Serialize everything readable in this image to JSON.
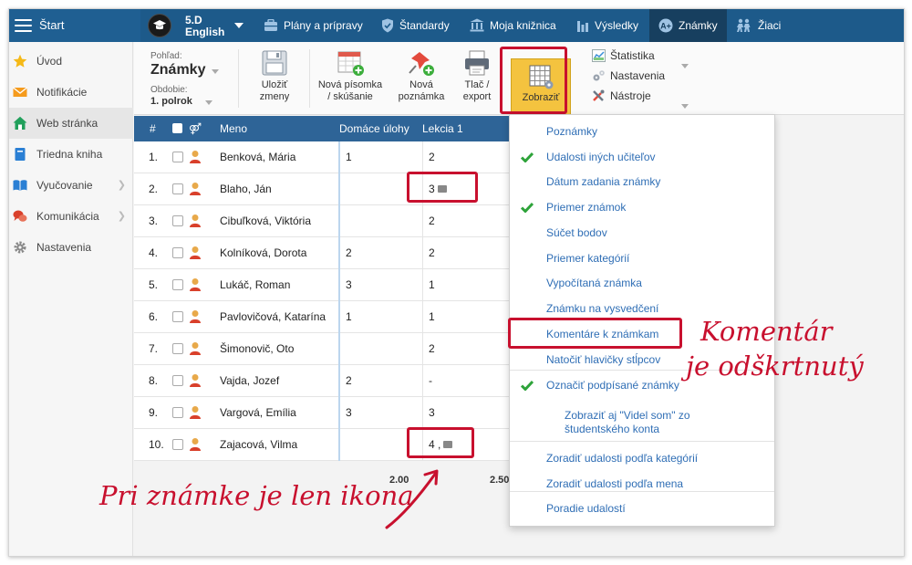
{
  "topbar": {
    "start_label": "Štart",
    "class_name": "5.D",
    "class_subject": "English",
    "nav": [
      {
        "label": "Plány a prípravy",
        "icon": "briefcase-icon"
      },
      {
        "label": "Štandardy",
        "icon": "shield-icon"
      },
      {
        "label": "Moja knižnica",
        "icon": "library-icon"
      },
      {
        "label": "Výsledky",
        "icon": "bar-chart-icon"
      },
      {
        "label": "Známky",
        "icon": "grades-icon"
      },
      {
        "label": "Žiaci",
        "icon": "students-icon"
      }
    ],
    "colors": {
      "bar": "#1d5a8a",
      "active": "#173f5f"
    }
  },
  "sidebar": {
    "items": [
      {
        "label": "Úvod",
        "icon": "star-icon"
      },
      {
        "label": "Notifikácie",
        "icon": "envelope-icon"
      },
      {
        "label": "Web stránka",
        "icon": "home-icon"
      },
      {
        "label": "Triedna kniha",
        "icon": "book-icon"
      },
      {
        "label": "Vyučovanie",
        "icon": "open-book-icon"
      },
      {
        "label": "Komunikácia",
        "icon": "chat-icon"
      },
      {
        "label": "Nastavenia",
        "icon": "gear-icon"
      }
    ]
  },
  "toolbar": {
    "view_label": "Pohľad:",
    "view_title": "Známky",
    "period_label": "Obdobie:",
    "period_value": "1. polrok",
    "save_line1": "Uložiť",
    "save_line2": "zmeny",
    "new_exam_line1": "Nová písomka",
    "new_exam_line2": "/ skúšanie",
    "new_grade_line1": "Nová",
    "new_grade_line2": "poznámka",
    "print_line1": "Tlač /",
    "print_line2": "export",
    "show_label": "Zobraziť",
    "statistics": "Štatistika",
    "settings": "Nastavenia",
    "tools": "Nástroje",
    "accent_color": "#f4c33f"
  },
  "grid": {
    "headers": {
      "num": "#",
      "gender": "⚤",
      "name": "Meno",
      "homework": "Domáce úlohy",
      "lesson": "Lekcia 1"
    },
    "rows": [
      {
        "num": "1.",
        "name": "Benková, Mária",
        "homework": "1",
        "lesson": "2"
      },
      {
        "num": "2.",
        "name": "Blaho, Ján",
        "homework": "",
        "lesson": "3"
      },
      {
        "num": "3.",
        "name": "Cibuľková, Viktória",
        "homework": "",
        "lesson": "2"
      },
      {
        "num": "4.",
        "name": "Kolníková, Dorota",
        "homework": "2",
        "lesson": "2"
      },
      {
        "num": "5.",
        "name": "Lukáč, Roman",
        "homework": "3",
        "lesson": "1"
      },
      {
        "num": "6.",
        "name": "Pavlovičová, Katarína",
        "homework": "1",
        "lesson": "1"
      },
      {
        "num": "7.",
        "name": "Šimonovič, Oto",
        "homework": "",
        "lesson": "2"
      },
      {
        "num": "8.",
        "name": "Vajda, Jozef",
        "homework": "2",
        "lesson": "-"
      },
      {
        "num": "9.",
        "name": "Vargová, Emília",
        "homework": "3",
        "lesson": "3"
      },
      {
        "num": "10.",
        "name": "Zajacová, Vilma",
        "homework": "",
        "lesson": "4 ,"
      }
    ],
    "averages": {
      "homework": "2.00",
      "lesson": "2.50"
    }
  },
  "menu": {
    "items": [
      {
        "label": "Poznámky",
        "checked": false
      },
      {
        "label": "Udalosti iných učiteľov",
        "checked": true
      },
      {
        "label": "Dátum zadania známky",
        "checked": false
      },
      {
        "label": "Priemer známok",
        "checked": true
      },
      {
        "label": "Súčet bodov",
        "checked": false
      },
      {
        "label": "Priemer kategórií",
        "checked": false
      },
      {
        "label": "Vypočítaná známka",
        "checked": false
      },
      {
        "label": "Známku na vysvedčení",
        "checked": false
      },
      {
        "label": "Komentáre k známkam",
        "checked": false
      },
      {
        "label": "Natočiť hlavičky stĺpcov",
        "checked": false
      },
      {
        "label": "Označiť podpísané známky",
        "checked": true
      },
      {
        "label": "Zobraziť aj \"Videl som\" zo študentského konta",
        "checked": false
      },
      {
        "label": "Zoradiť udalosti podľa kategórií",
        "checked": false
      },
      {
        "label": "Zoradiť udalosti podľa mena",
        "checked": false
      },
      {
        "label": "Poradie udalostí",
        "checked": false
      }
    ]
  },
  "annotations": {
    "komentar": "Komentár",
    "odskrtnuty": "je odškrtnutý",
    "pri_znamke": "Pri známke je len ikona",
    "color": "#c8102e"
  }
}
